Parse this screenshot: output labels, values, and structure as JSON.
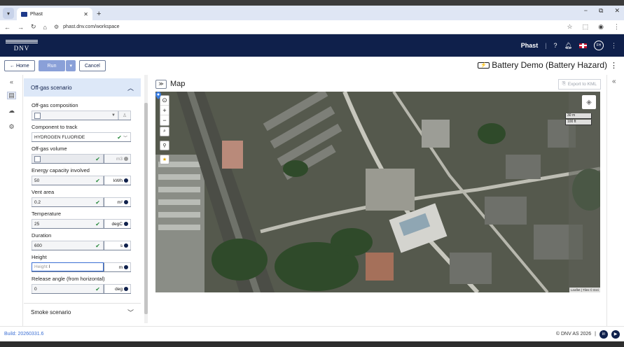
{
  "browser": {
    "tab_title": "Phast",
    "url": "phast.dnv.com/workspace"
  },
  "appbar": {
    "logo_text": "DNV",
    "app_name": "Phast",
    "user_initials": "FH"
  },
  "toolbar": {
    "home_label": "← Home",
    "run_label": "Run",
    "cancel_label": "Cancel",
    "document_title": "Battery Demo (Battery Hazard)"
  },
  "panel": {
    "section_title": "Off-gas scenario",
    "fields": {
      "composition_label": "Off-gas composition",
      "component_label": "Component to track",
      "component_value": "HYDROGEN FLUORIDE",
      "volume_label": "Off-gas volume",
      "volume_unit": "m3",
      "energy_label": "Energy capacity involved",
      "energy_value": "50",
      "energy_unit": "kWh",
      "vent_label": "Vent area",
      "vent_value": "0.2",
      "vent_unit": "m²",
      "temp_label": "Temperature",
      "temp_value": "25",
      "temp_unit": "degC",
      "duration_label": "Duration",
      "duration_value": "600",
      "duration_unit": "s",
      "height_label": "Height",
      "height_placeholder": "Height",
      "height_unit": "m",
      "angle_label": "Release angle (from horizontal)",
      "angle_value": "0",
      "angle_unit": "deg"
    },
    "smoke_section": "Smoke scenario"
  },
  "map": {
    "title": "Map",
    "export_label": "Export to KML",
    "scale_m": "30 m",
    "scale_ft": "100 ft",
    "attribution": "Leaflet | Tiles © Esri"
  },
  "footer": {
    "build": "Build: 20260331.6",
    "copyright": "© DNV AS 2026"
  }
}
